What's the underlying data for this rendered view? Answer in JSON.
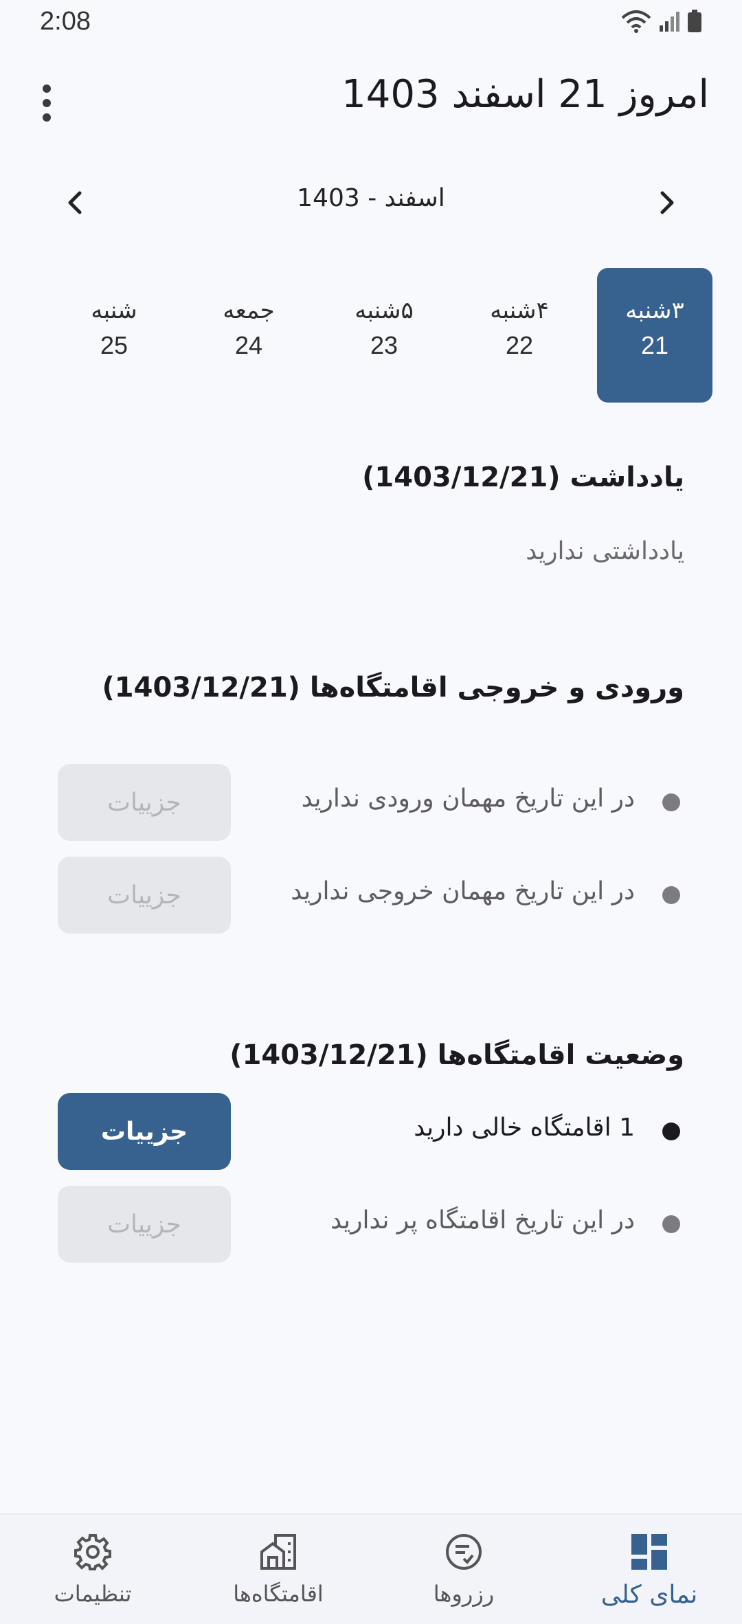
{
  "status_bar": {
    "time": "2:08"
  },
  "header": {
    "title": "امروز 21 اسفند 1403"
  },
  "month_nav": {
    "label": "اسفند - 1403"
  },
  "days": [
    {
      "name": "۳شنبه",
      "num": "21",
      "selected": true
    },
    {
      "name": "۴شنبه",
      "num": "22"
    },
    {
      "name": "۵شنبه",
      "num": "23"
    },
    {
      "name": "جمعه",
      "num": "24"
    },
    {
      "name": "شنبه",
      "num": "25"
    }
  ],
  "notes": {
    "title": "یادداشت (1403/12/21)",
    "empty_text": "یادداشتی ندارید"
  },
  "checkinout": {
    "title": "ورودی و خروجی اقامتگاه‌ها (1403/12/21)",
    "rows": [
      {
        "text": "در این تاریخ مهمان ورودی ندارید",
        "button": "جزییات"
      },
      {
        "text": "در این تاریخ مهمان خروجی ندارید",
        "button": "جزییات"
      }
    ]
  },
  "status": {
    "title": "وضعیت اقامتگاه‌ها (1403/12/21)",
    "rows": [
      {
        "text": "1 اقامتگاه خالی دارید",
        "button": "جزییات"
      },
      {
        "text": "در این تاریخ اقامتگاه پر ندارید",
        "button": "جزییات"
      }
    ]
  },
  "bottom_nav": {
    "tabs": [
      {
        "label": "نمای کلی",
        "icon": "dashboard-icon",
        "active": true
      },
      {
        "label": "رزروها",
        "icon": "reservations-icon"
      },
      {
        "label": "اقامتگاه‌ها",
        "icon": "properties-icon"
      },
      {
        "label": "تنظیمات",
        "icon": "gear-icon"
      }
    ]
  },
  "colors": {
    "accent": "#37618e",
    "background": "#f8f9fd",
    "disabled_button": "#e6e7eb"
  }
}
